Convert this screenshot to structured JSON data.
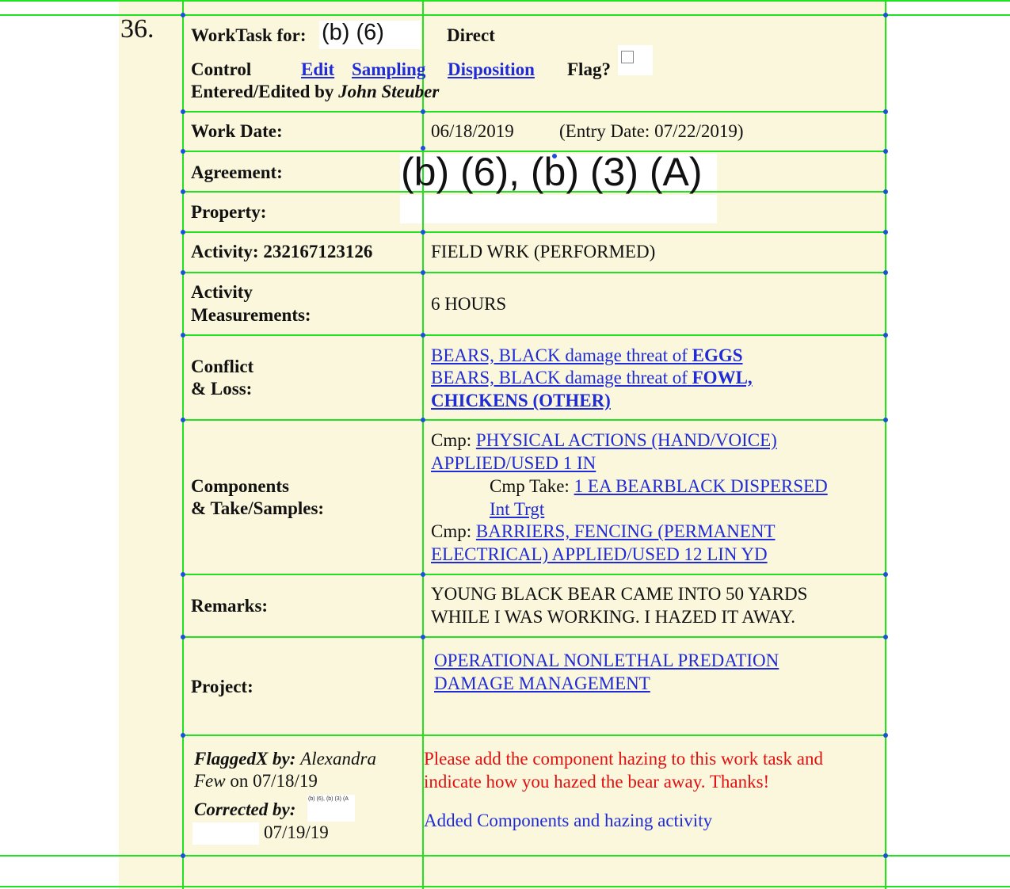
{
  "record_number": "36.",
  "header": {
    "worktask_label": "WorkTask for:",
    "worktask_redaction": "(b) (6)",
    "direct_label": "Direct",
    "control_label": "Control",
    "edit_link": "Edit",
    "sampling_link": "Sampling",
    "disposition_link": "Disposition",
    "flag_label": "Flag?",
    "entered_label": "Entered/Edited by",
    "entered_by": "John Steuber"
  },
  "work_date": {
    "label": "Work Date:",
    "value": "06/18/2019",
    "entry_date": "(Entry Date: 07/22/2019)"
  },
  "agreement": {
    "label": "Agreement:",
    "redaction": "(b) (6), (b) (3) (A)"
  },
  "property": {
    "label": "Property:"
  },
  "activity": {
    "label": "Activity: 232167123126",
    "value": "FIELD WRK (PERFORMED)"
  },
  "activity_measurements": {
    "label_line1": "Activity",
    "label_line2": "Measurements:",
    "value": "6 HOURS"
  },
  "conflict_loss": {
    "label_line1": "Conflict",
    "label_line2": "& Loss:",
    "line1_prefix": "BEARS, BLACK damage threat of",
    "line1_bold": "EGGS",
    "line2_prefix": "BEARS, BLACK damage threat of",
    "line2_bold": "FOWL,",
    "line3_bold": "CHICKENS (OTHER)"
  },
  "components": {
    "label_line1": "Components",
    "label_line2": "& Take/Samples:",
    "cmp_label": "Cmp:",
    "cmp1_line1": "PHYSICAL ACTIONS (HAND/VOICE)",
    "cmp1_line2": "APPLIED/USED 1 IN",
    "take_label": "Cmp Take:",
    "take_line1": "1 EA BEARBLACK DISPERSED",
    "take_line2": "Int Trgt",
    "cmp2_line1": "BARRIERS, FENCING (PERMANENT",
    "cmp2_line2": "ELECTRICAL) APPLIED/USED 12 LIN YD"
  },
  "remarks": {
    "label": "Remarks:",
    "line1": "YOUNG BLACK BEAR CAME INTO 50 YARDS",
    "line2": "WHILE I WAS WORKING. I HAZED IT AWAY."
  },
  "project": {
    "label": "Project:",
    "line1": "OPERATIONAL NONLETHAL PREDATION",
    "line2": "DAMAGE MANAGEMENT"
  },
  "flag_info": {
    "flagged_label": "FlaggedX by:",
    "flagged_first": "Alexandra",
    "flagged_last": "Few",
    "flagged_on": "on 07/18/19",
    "corrected_label": "Corrected by:",
    "corrected_redaction": "(b) (6), (b) (3) (A",
    "corrected_date": "07/19/19",
    "message_line1": "Please add the component hazing to this work task and",
    "message_line2": "indicate how you hazed the bear away. Thanks!",
    "response": "Added Components and hazing activity"
  },
  "colors": {
    "background": "#fbf7dc",
    "grid": "#22e022",
    "link": "#1f2bd6",
    "flag_message": "#e01010"
  }
}
